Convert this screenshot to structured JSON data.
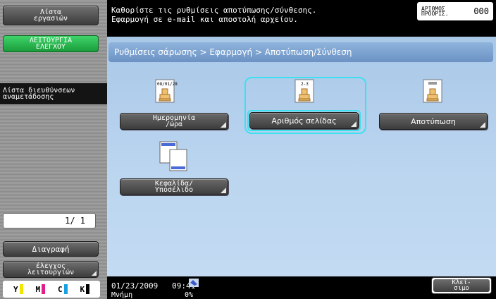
{
  "sidebar": {
    "utility_label": "Λίστα\nεργασιών",
    "function_check_label": "ΛΕΙΤΟΥΡΓΙΑ\nΕΛΕΓΧΟΥ",
    "address_list_label": "Λίστα διευθύνσεων\nαναμετάδοσης",
    "page_indicator": "1/  1",
    "delete_label": "Διαγραφή",
    "check_function_label": "έλεγχος\nλειτουργιών",
    "toner": [
      {
        "label": "Y",
        "color": "#f2e600"
      },
      {
        "label": "M",
        "color": "#e0208a"
      },
      {
        "label": "C",
        "color": "#1aa0e0"
      },
      {
        "label": "K",
        "color": "#000000"
      }
    ]
  },
  "header": {
    "message_line1": "Καθορίστε τις ρυθμίσεις αποτύπωσης/σύνθεσης.",
    "message_line2": "Εφαρμογή σε e-mail και αποστολή αρχείου.",
    "counter_label": "ΑΡΙΘΜΟΣ\nΠΡΟΟΡΙΣ.",
    "counter_value": "000"
  },
  "breadcrumb": "Ρυθμίσεις σάρωσης > Εφαρμογή > Αποτύπωση/Σύνθεση",
  "functions": [
    {
      "label": "Ημερομηνία\n/ώρα",
      "icon": "date-stamp-icon",
      "icon_text": "08/01/28"
    },
    {
      "label": "Αριθμός σελίδας",
      "icon": "page-number-icon",
      "icon_text": "2-3",
      "selected": true
    },
    {
      "label": "Αποτύπωση",
      "icon": "stamp-icon"
    },
    {
      "label": "Κεφαλίδα/\nΥποσέλιδο",
      "icon": "header-footer-icon"
    }
  ],
  "status": {
    "datetime": "01/23/2009   09:41",
    "memory_label": "Μνήμη",
    "memory_value": "0%",
    "close_label": "Κλεί-\nσιμο"
  },
  "colors": {
    "accent_highlight": "#3ee0f0",
    "panel_blue": "#b5d1ee",
    "function_check_green": "#28b44c"
  }
}
